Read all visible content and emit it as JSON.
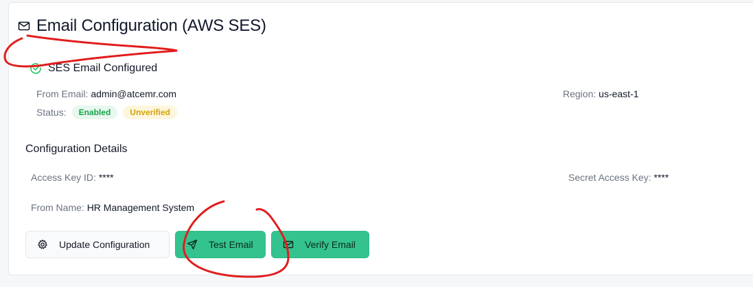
{
  "header": {
    "title": "Email Configuration (AWS SES)",
    "title_icon": "mail-icon"
  },
  "status": {
    "label": "SES Email Configured",
    "icon": "check-circle-icon",
    "icon_color": "#22c55e"
  },
  "info": {
    "from_email_label": "From Email:",
    "from_email_value": "admin@atcemr.com",
    "region_label": "Region:",
    "region_value": "us-east-1",
    "status_label": "Status:",
    "badge_enabled": "Enabled",
    "badge_unverified": "Unverified"
  },
  "details": {
    "title": "Configuration Details",
    "access_key_label": "Access Key ID:",
    "access_key_value": "****",
    "secret_key_label": "Secret Access Key:",
    "secret_key_value": "****",
    "from_name_label": "From Name:",
    "from_name_value": "HR Management System"
  },
  "buttons": {
    "update": "Update Configuration",
    "test": "Test Email",
    "verify": "Verify Email"
  },
  "colors": {
    "accent_green": "#34c38f",
    "annotation_red": "#e11d1d"
  }
}
